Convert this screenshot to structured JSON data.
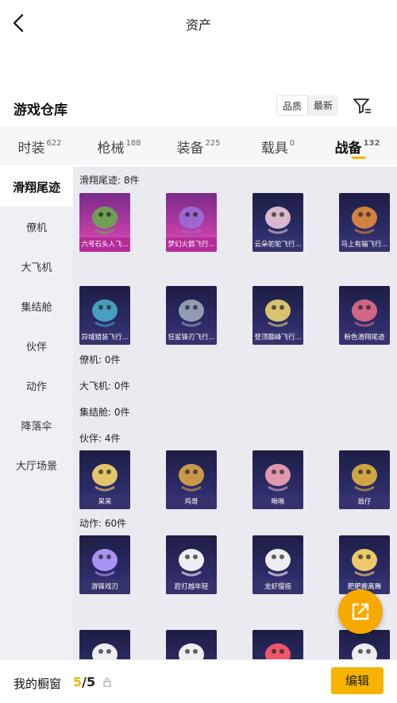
{
  "header": {
    "title": "资产"
  },
  "warehouse": {
    "title": "游戏仓库",
    "sort_options": [
      "品质",
      "最新"
    ],
    "sort_selected": "品质"
  },
  "tabs": [
    {
      "label": "时装",
      "count": "622",
      "active": false
    },
    {
      "label": "枪械",
      "count": "188",
      "active": false
    },
    {
      "label": "装备",
      "count": "225",
      "active": false
    },
    {
      "label": "载具",
      "count": "0",
      "active": false
    },
    {
      "label": "战备",
      "count": "132",
      "active": true
    }
  ],
  "sidebar": {
    "items": [
      "滑翔尾迹",
      "僚机",
      "大飞机",
      "集结舱",
      "伙伴",
      "动作",
      "降落伞",
      "大厅场景"
    ],
    "active_index": 0
  },
  "sections": [
    {
      "label": "滑翔尾迹: 8件",
      "items": [
        {
          "name": "六号石头人飞...",
          "rarity": "pink",
          "icon": "plant-creature-icon"
        },
        {
          "name": "梦幻火箭飞行...",
          "rarity": "pink",
          "icon": "rocket-wing-icon"
        },
        {
          "name": "云朵驼驼飞行...",
          "rarity": "purple",
          "icon": "alpaca-icon"
        },
        {
          "name": "马上有福飞行...",
          "rarity": "purple",
          "icon": "pony-icon"
        },
        {
          "name": "异域猎装飞行...",
          "rarity": "purple",
          "icon": "dragon-wing-icon"
        },
        {
          "name": "狂鲨锋刃飞行...",
          "rarity": "purple",
          "icon": "shark-jet-icon"
        },
        {
          "name": "登顶巅峰飞行...",
          "rarity": "purple",
          "icon": "gold-jet-icon"
        },
        {
          "name": "粉色滑翔尾迹",
          "rarity": "purple",
          "icon": "pink-trail-icon"
        }
      ]
    },
    {
      "label": "僚机: 0件",
      "items": []
    },
    {
      "label": "大飞机: 0件",
      "items": []
    },
    {
      "label": "集结舱: 0件",
      "items": []
    },
    {
      "label": "伙伴: 4件",
      "items": [
        {
          "name": "呆呆",
          "rarity": "purple",
          "icon": "chick-icon"
        },
        {
          "name": "鸡哥",
          "rarity": "purple",
          "icon": "rooster-icon"
        },
        {
          "name": "啾啾",
          "rarity": "purple",
          "icon": "pink-bird-icon"
        },
        {
          "name": "翁仔",
          "rarity": "purple",
          "icon": "knight-chick-icon"
        }
      ]
    },
    {
      "label": "动作: 60件",
      "items": [
        {
          "name": "游锋戏刃",
          "rarity": "purple",
          "icon": "emote-blade-icon"
        },
        {
          "name": "趁打越年轻",
          "rarity": "purple",
          "icon": "emote-dance-icon"
        },
        {
          "name": "龙虾慢摇",
          "rarity": "purple",
          "icon": "emote-sway-icon"
        },
        {
          "name": "肥肥搬离舞",
          "rarity": "purple",
          "icon": "emote-burst-icon"
        },
        {
          "name": "",
          "rarity": "purple",
          "icon": "emote-jump-icon"
        },
        {
          "name": "",
          "rarity": "purple",
          "icon": "emote-wave-icon"
        },
        {
          "name": "",
          "rarity": "purple",
          "icon": "emote-spin-icon"
        },
        {
          "name": "",
          "rarity": "purple",
          "icon": "emote-pose-icon"
        }
      ]
    }
  ],
  "colors": {
    "accent": "#f6b400",
    "pink_rarity": "#c23fa8",
    "purple_rarity": "#3b3a7a"
  },
  "showcase": {
    "label": "我的橱窗",
    "current": "5",
    "separator": "/",
    "total": "5",
    "edit_label": "编辑"
  }
}
